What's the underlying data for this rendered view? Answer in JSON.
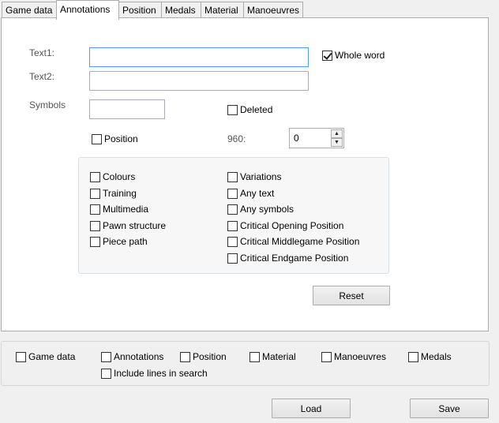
{
  "tabs": [
    {
      "label": "Game data",
      "active": false
    },
    {
      "label": "Annotations",
      "active": true
    },
    {
      "label": "Position",
      "active": false
    },
    {
      "label": "Medals",
      "active": false
    },
    {
      "label": "Material",
      "active": false
    },
    {
      "label": "Manoeuvres",
      "active": false
    }
  ],
  "fields": {
    "text1_label": "Text1:",
    "text1_value": "",
    "text2_label": "Text2:",
    "text2_value": "",
    "symbols_label": "Symbols",
    "symbols_value": "",
    "whole_word_label": "Whole word",
    "whole_word_checked": true,
    "deleted_label": "Deleted",
    "position_label": "Position",
    "chess960_label": "960:",
    "chess960_value": "0"
  },
  "options_left": [
    "Colours",
    "Training",
    "Multimedia",
    "Pawn structure",
    "Piece path"
  ],
  "options_right": [
    "Variations",
    "Any text",
    "Any symbols",
    "Critical Opening Position",
    "Critical Middlegame Position",
    "Critical Endgame Position"
  ],
  "reset_label": "Reset",
  "bottom": {
    "game_data": "Game data",
    "annotations": "Annotations",
    "position": "Position",
    "material": "Material",
    "manoeuvres": "Manoeuvres",
    "medals": "Medals",
    "include_lines": "Include lines in search"
  },
  "load_label": "Load",
  "save_label": "Save"
}
